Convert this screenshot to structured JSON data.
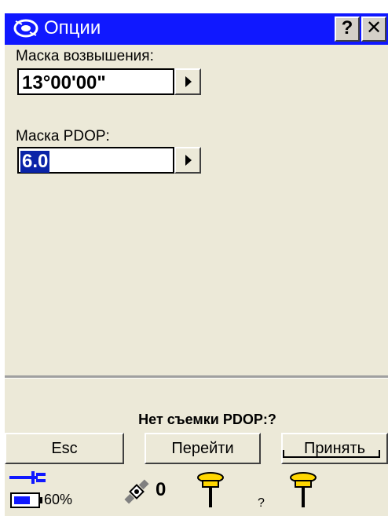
{
  "window": {
    "title": "Опции",
    "help_label": "?",
    "close_label": "✕"
  },
  "fields": {
    "elevation": {
      "label": "Маска возвышения:",
      "value": "13°00'00\""
    },
    "pdop": {
      "label": "Маска PDOP:",
      "value": "6.0"
    }
  },
  "status": {
    "text": "Нет съемки  PDOP:?"
  },
  "buttons": {
    "esc": "Esc",
    "go": "Перейти",
    "accept": "Принять"
  },
  "bottombar": {
    "battery_percent": "60%",
    "satellite_count": "0",
    "unknown_mark": "?"
  },
  "colors": {
    "titlebar": "#1018ff",
    "panel": "#ece9d8",
    "selection": "#0a24a8"
  }
}
